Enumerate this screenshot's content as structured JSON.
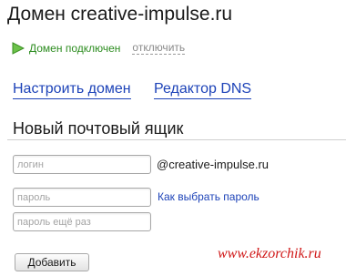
{
  "page": {
    "title": "Домен creative-impulse.ru"
  },
  "status": {
    "icon": "green-triangle-icon",
    "text": "Домен подключен",
    "disconnect_label": "отключить",
    "color": "#2c8c1f"
  },
  "links": {
    "configure_domain": "Настроить домен",
    "dns_editor": "Редактор DNS",
    "color": "#1d43b8"
  },
  "mailbox_form": {
    "title": "Новый почтовый ящик",
    "login": {
      "placeholder": "логин",
      "value": ""
    },
    "domain_suffix": "@creative-impulse.ru",
    "password": {
      "placeholder": "пароль",
      "value": ""
    },
    "password_help_link": "Как выбрать пароль",
    "password_repeat": {
      "placeholder": "пароль ещё раз",
      "value": ""
    },
    "submit_label": "Добавить"
  },
  "watermark": {
    "text": "www.ekzorchik.ru",
    "color": "#d01818"
  }
}
